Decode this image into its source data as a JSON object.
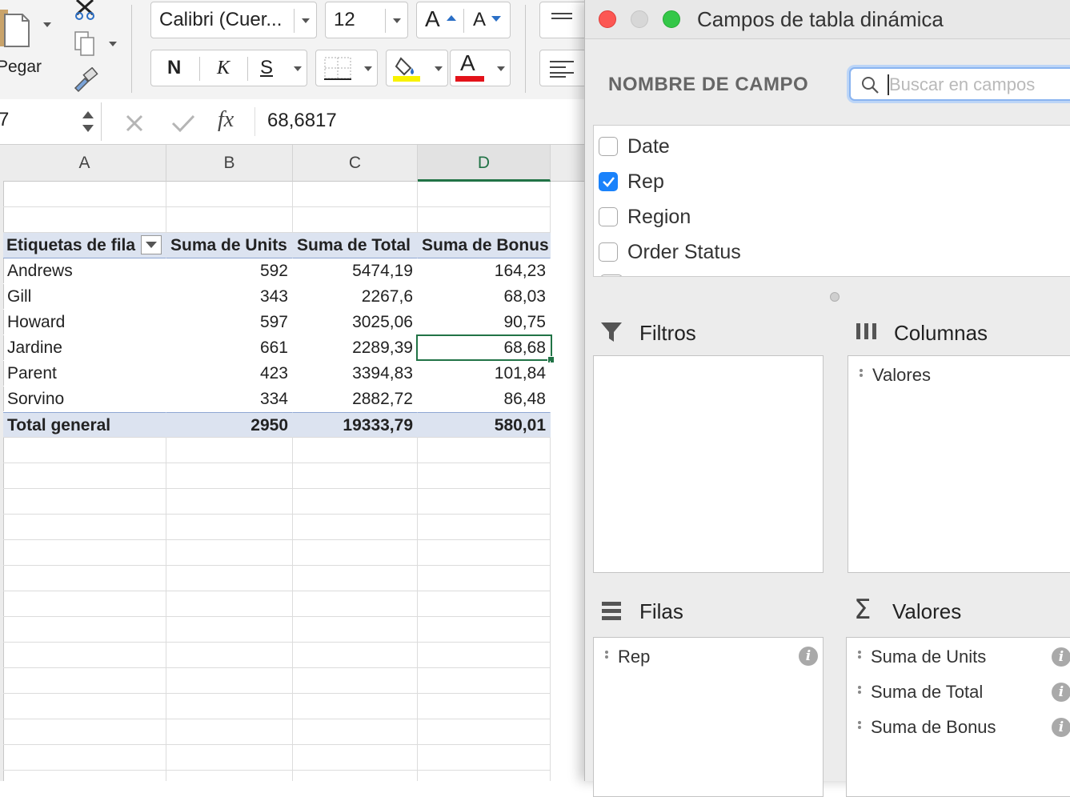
{
  "ribbon": {
    "paste_label": "Pegar",
    "font_name": "Calibri (Cuer...",
    "font_size": "12",
    "grow_font": "A",
    "shrink_font": "A",
    "bold": "N",
    "italic": "K",
    "underline": "S",
    "font_color_letter": "A",
    "highlight_color": "#f8f200",
    "font_color": "#e3121a"
  },
  "formula_bar": {
    "name_box": "7",
    "fx": "fx",
    "value": "68,6817"
  },
  "grid": {
    "columns": [
      "A",
      "B",
      "C",
      "D"
    ],
    "header": [
      "Etiquetas de fila",
      "Suma de Units",
      "Suma de Total",
      "Suma de Bonus"
    ],
    "rows": [
      [
        "Andrews",
        "592",
        "5474,19",
        "164,23"
      ],
      [
        "Gill",
        "343",
        "2267,6",
        "68,03"
      ],
      [
        "Howard",
        "597",
        "3025,06",
        "90,75"
      ],
      [
        "Jardine",
        "661",
        "2289,39",
        "68,68"
      ],
      [
        "Parent",
        "423",
        "3394,83",
        "101,84"
      ],
      [
        "Sorvino",
        "334",
        "2882,72",
        "86,48"
      ]
    ],
    "total": [
      "Total general",
      "2950",
      "19333,79",
      "580,01"
    ],
    "selected_color": "#217346"
  },
  "panel": {
    "title": "Campos de tabla dinámica",
    "field_name_header": "NOMBRE DE CAMPO",
    "search_placeholder": "Buscar en campos",
    "fields": [
      {
        "label": "Date",
        "checked": false
      },
      {
        "label": "Rep",
        "checked": true
      },
      {
        "label": "Region",
        "checked": false
      },
      {
        "label": "Order Status",
        "checked": false
      }
    ],
    "areas": {
      "filters": {
        "title": "Filtros",
        "items": []
      },
      "columns": {
        "title": "Columnas",
        "items": [
          "Valores"
        ]
      },
      "rows": {
        "title": "Filas",
        "items": [
          "Rep"
        ]
      },
      "values": {
        "title": "Valores",
        "items": [
          "Suma de Units",
          "Suma de Total",
          "Suma de Bonus"
        ]
      }
    },
    "info_glyph": "i",
    "sigma": "Σ"
  }
}
